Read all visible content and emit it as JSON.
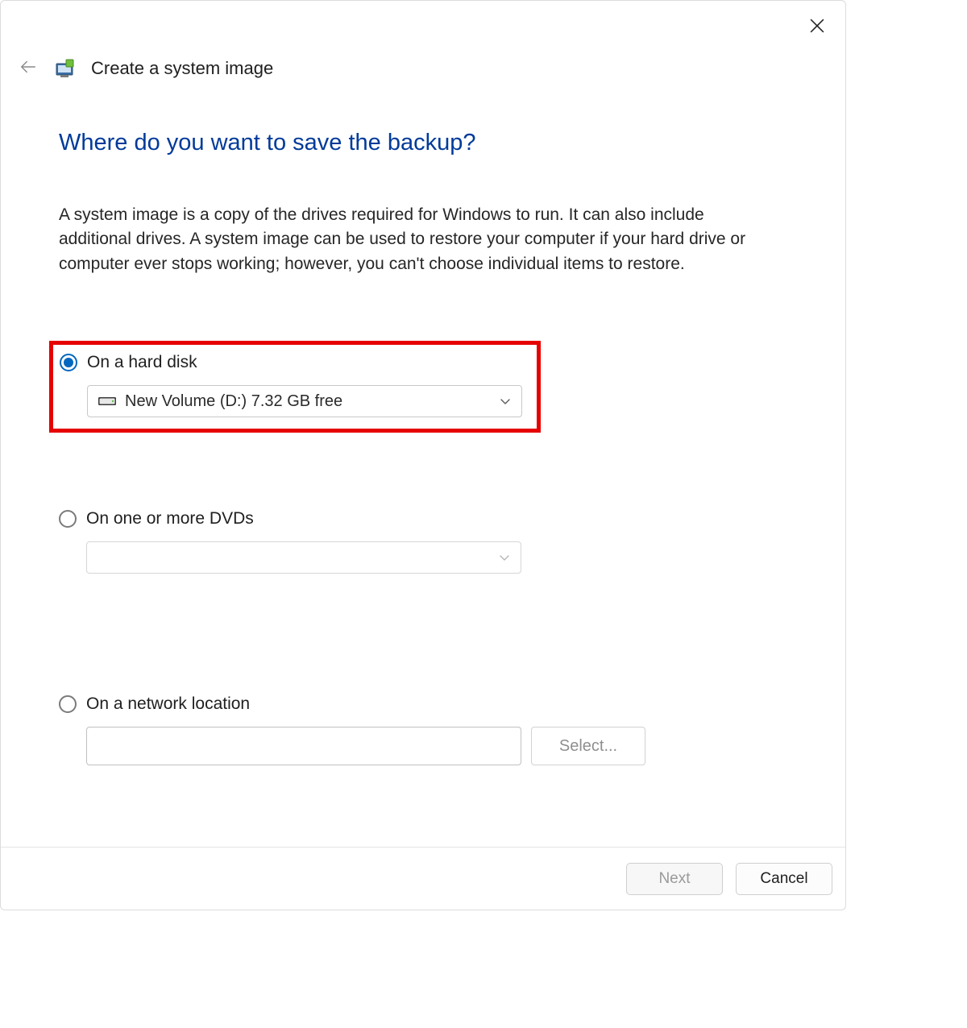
{
  "window": {
    "title": "Create a system image"
  },
  "page": {
    "heading": "Where do you want to save the backup?",
    "description": "A system image is a copy of the drives required for Windows to run. It can also include additional drives. A system image can be used to restore your computer if your hard drive or computer ever stops working; however, you can't choose individual items to restore."
  },
  "options": {
    "hard_disk": {
      "label": "On a hard disk",
      "selected_drive": "New Volume (D:)  7.32 GB free"
    },
    "dvd": {
      "label": "On one or more DVDs",
      "selected": ""
    },
    "network": {
      "label": "On a network location",
      "path": "",
      "select_button": "Select..."
    }
  },
  "footer": {
    "next": "Next",
    "cancel": "Cancel"
  }
}
